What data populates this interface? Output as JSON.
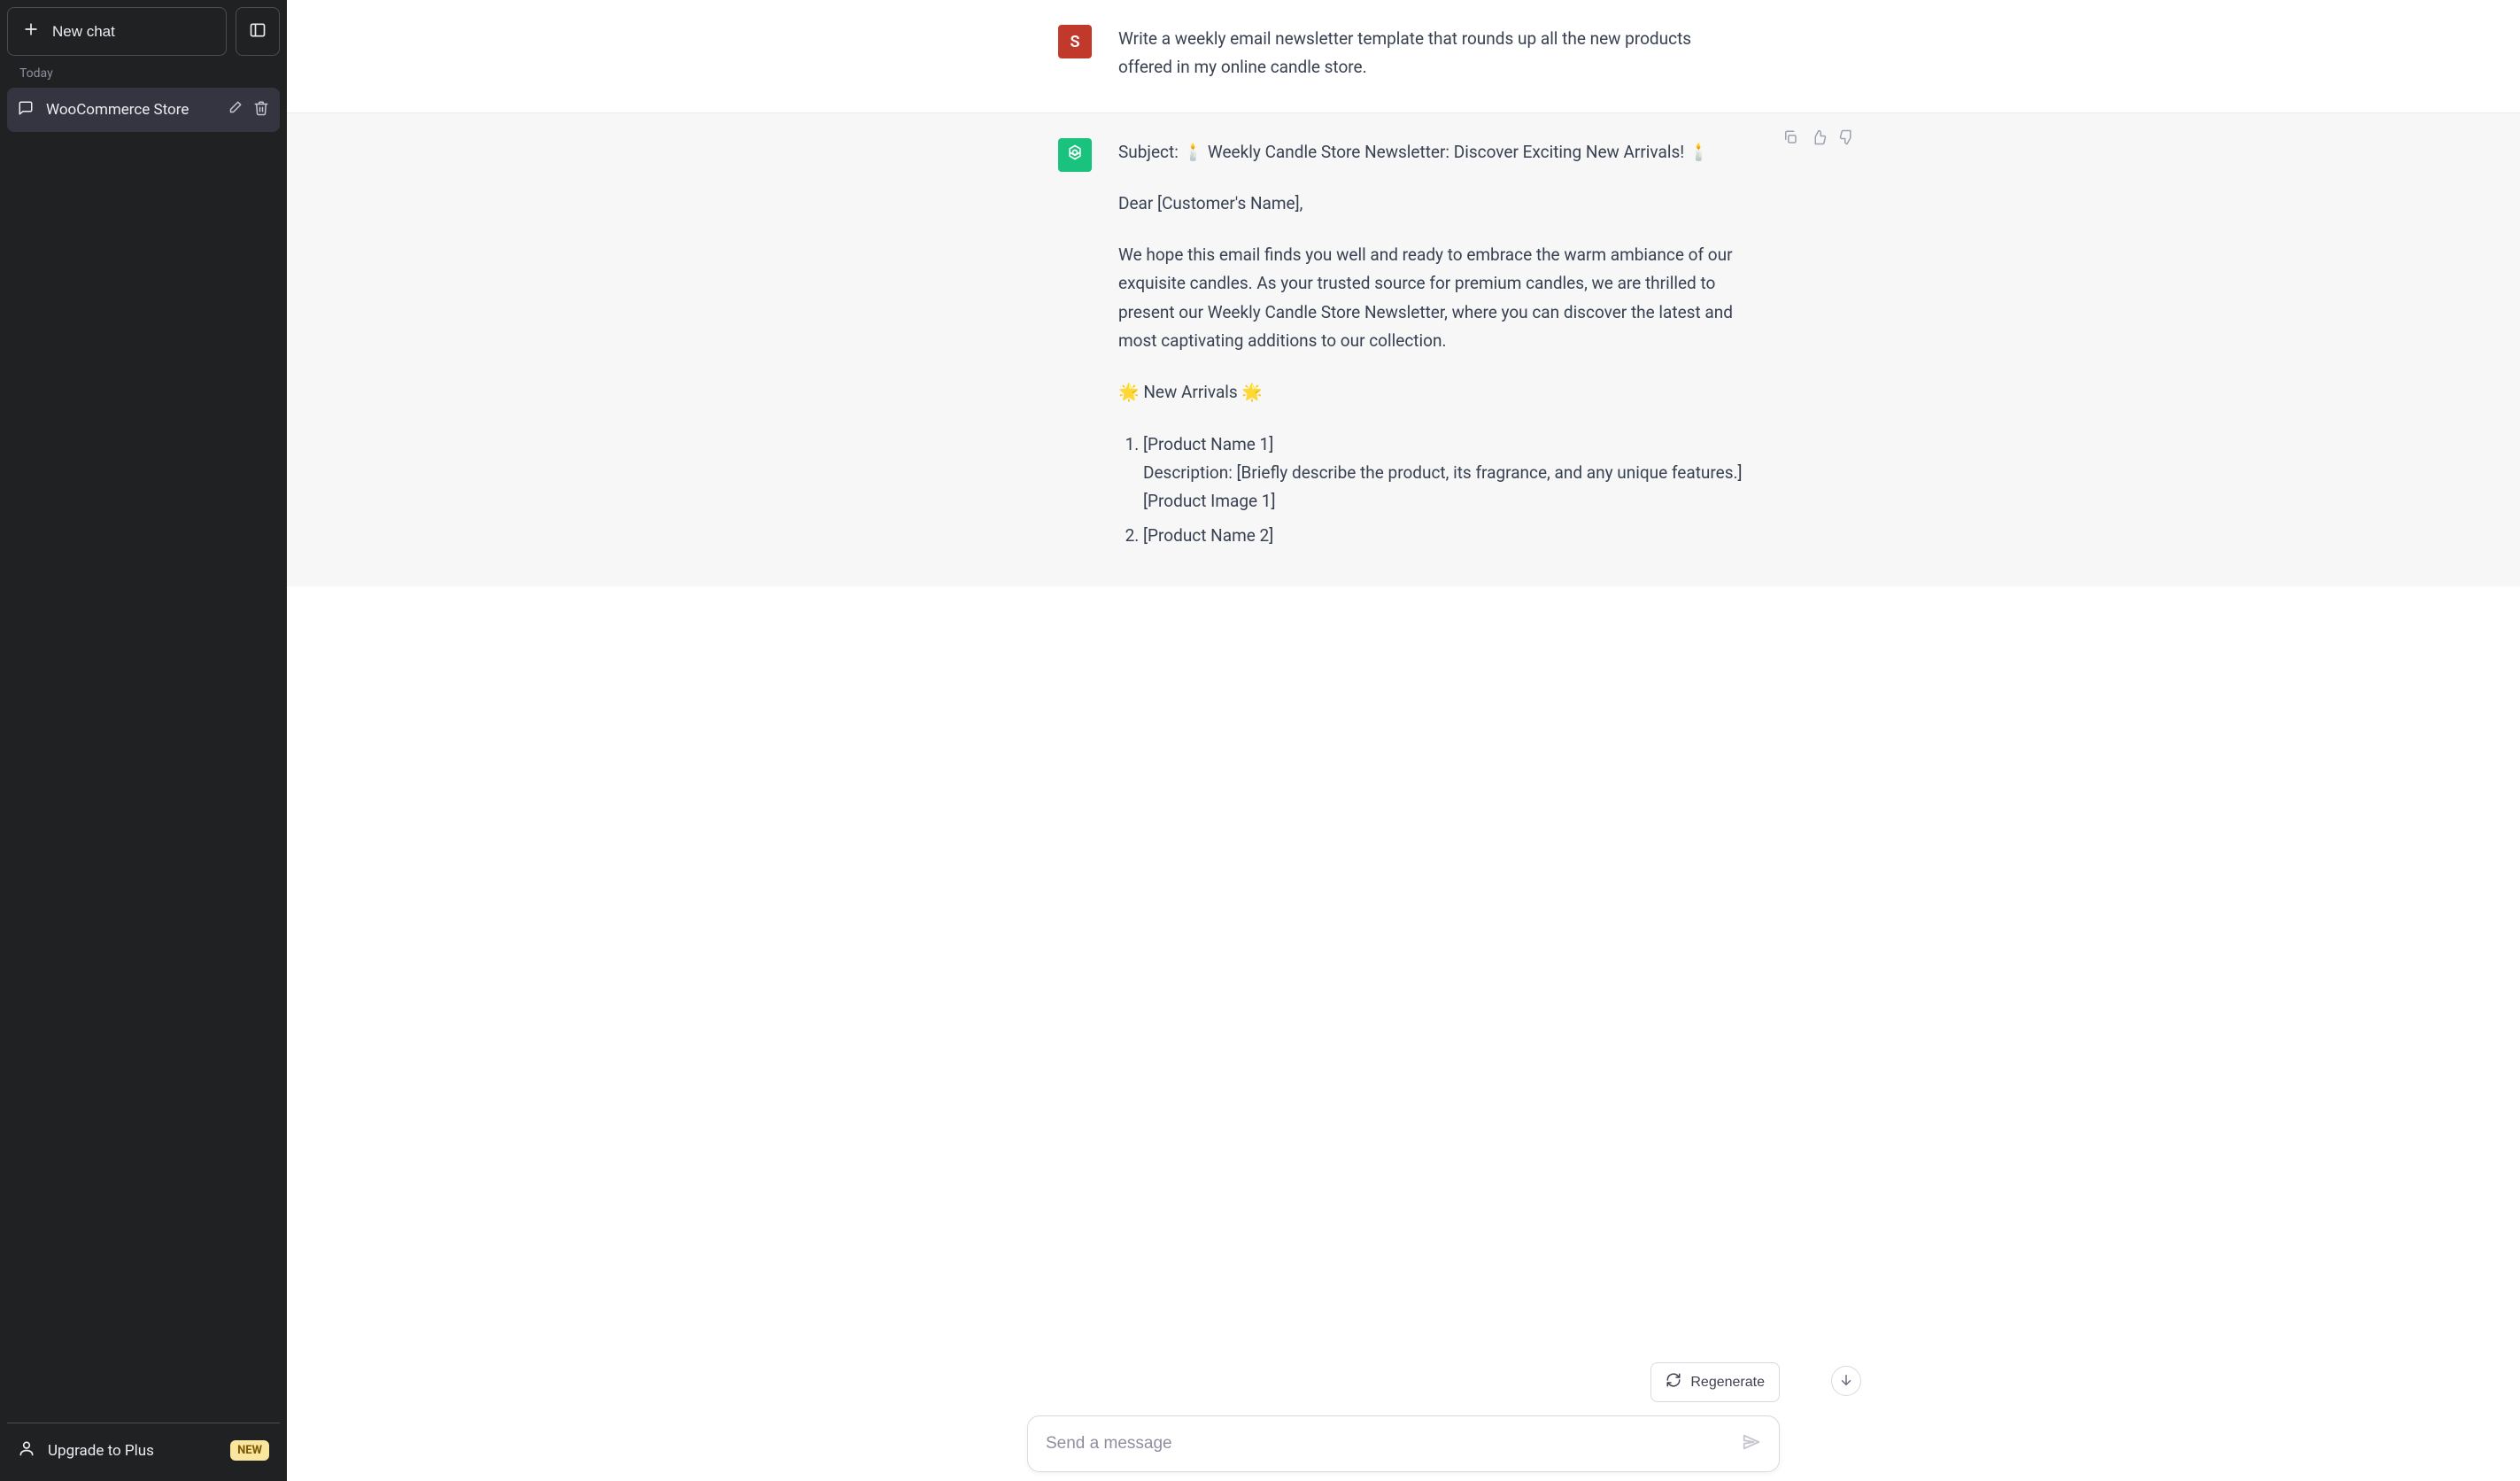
{
  "sidebar": {
    "new_chat_label": "New chat",
    "section_today": "Today",
    "items": [
      {
        "title": "WooCommerce Store"
      }
    ],
    "upgrade_label": "Upgrade to Plus",
    "upgrade_badge": "NEW"
  },
  "conversation": {
    "user_avatar_letter": "S",
    "user_message": "Write a weekly email newsletter template that rounds up all the new products offered in my online candle store.",
    "assistant": {
      "subject_line": "Subject: 🕯️ Weekly Candle Store Newsletter: Discover Exciting New Arrivals! 🕯️",
      "greeting": "Dear [Customer's Name],",
      "intro": "We hope this email finds you well and ready to embrace the warm ambiance of our exquisite candles. As your trusted source for premium candles, we are thrilled to present our Weekly Candle Store Newsletter, where you can discover the latest and most captivating additions to our collection.",
      "arrivals_header": "🌟 New Arrivals 🌟",
      "items": [
        {
          "name": "[Product Name 1]",
          "description": "Description: [Briefly describe the product, its fragrance, and any unique features.]",
          "image": "[Product Image 1]"
        },
        {
          "name": "[Product Name 2]"
        }
      ]
    }
  },
  "controls": {
    "regenerate_label": "Regenerate",
    "composer_placeholder": "Send a message"
  }
}
